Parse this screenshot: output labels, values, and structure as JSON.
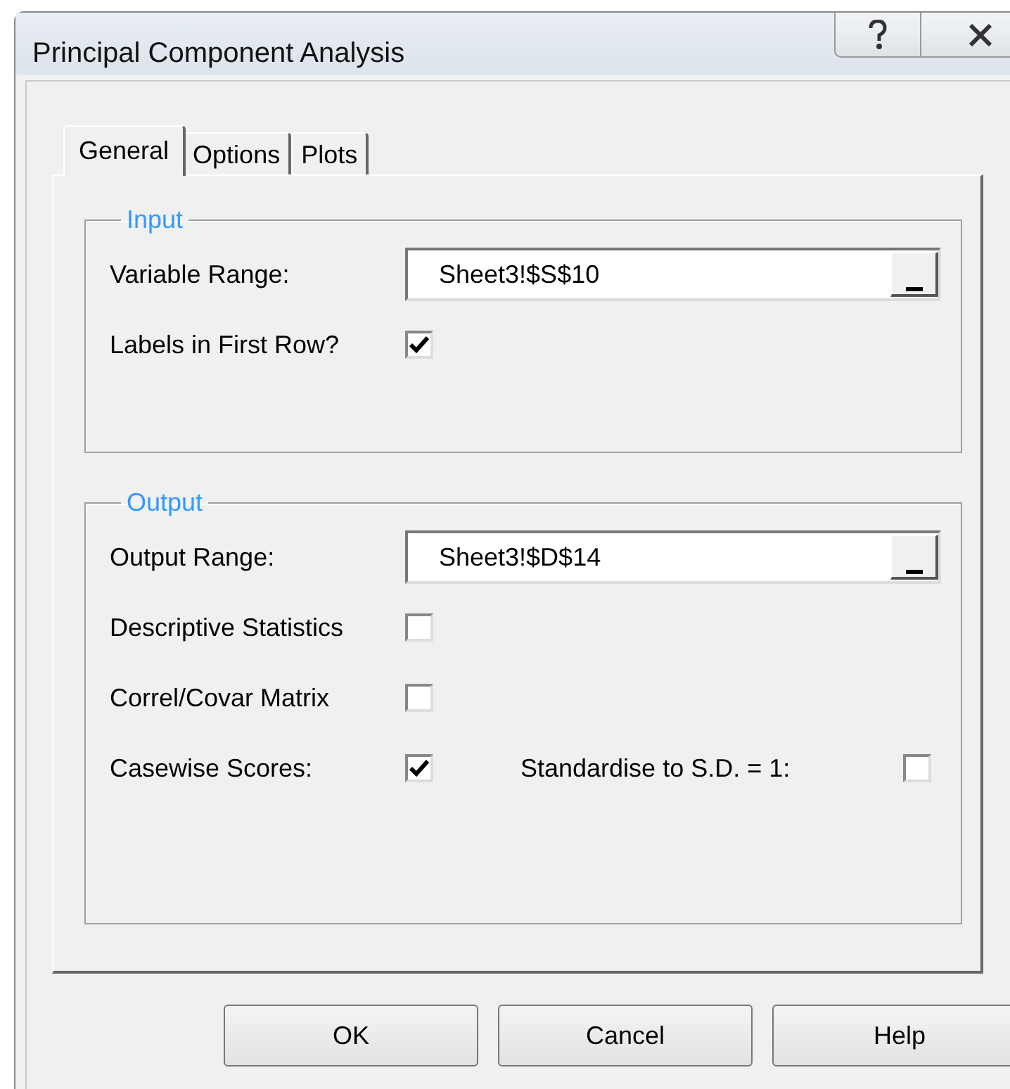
{
  "window": {
    "title": "Principal Component Analysis"
  },
  "tabs": [
    {
      "label": "General",
      "selected": true
    },
    {
      "label": "Options",
      "selected": false
    },
    {
      "label": "Plots",
      "selected": false
    }
  ],
  "groups": [
    {
      "title": "Input",
      "rows": [
        {
          "kind": "field",
          "label": "Variable Range:",
          "value": "Sheet3!$S$10"
        },
        {
          "kind": "checkbox",
          "label": "Labels in First Row?",
          "checked": true
        }
      ]
    },
    {
      "title": "Output",
      "rows": [
        {
          "kind": "field",
          "label": "Output Range:",
          "value": "Sheet3!$D$14"
        },
        {
          "kind": "checkbox",
          "label": "Descriptive Statistics",
          "checked": false
        },
        {
          "kind": "checkbox",
          "label": "Correl/Covar Matrix",
          "checked": false
        },
        {
          "kind": "checkbox",
          "label": "Casewise Scores:",
          "checked": true,
          "side": {
            "label": "Standardise to S.D. = 1:",
            "checked": false
          }
        }
      ]
    }
  ],
  "buttons": [
    "OK",
    "Cancel",
    "Help"
  ]
}
